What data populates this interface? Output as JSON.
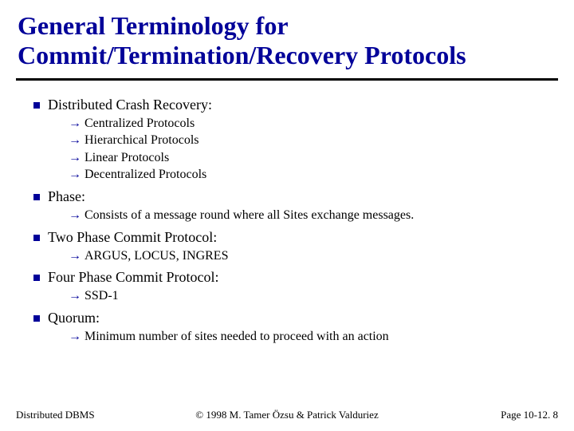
{
  "title_line1": "General Terminology for",
  "title_line2": "Commit/Termination/Recovery Protocols",
  "items": [
    {
      "label": "Distributed Crash Recovery:",
      "subs": [
        "Centralized Protocols",
        "Hierarchical Protocols",
        "Linear Protocols",
        "Decentralized Protocols"
      ]
    },
    {
      "label": "Phase:",
      "subs": [
        "Consists of a message round where all Sites exchange messages."
      ]
    },
    {
      "label": "Two Phase Commit Protocol:",
      "subs": [
        "ARGUS, LOCUS, INGRES"
      ]
    },
    {
      "label": "Four Phase Commit Protocol:",
      "subs": [
        "SSD-1"
      ]
    },
    {
      "label": "Quorum:",
      "subs": [
        "Minimum number of sites needed to proceed with an action"
      ]
    }
  ],
  "footer": {
    "left": "Distributed DBMS",
    "center": "© 1998 M. Tamer Özsu & Patrick Valduriez",
    "right": "Page 10-12. 8"
  },
  "arrow_glyph": "→"
}
